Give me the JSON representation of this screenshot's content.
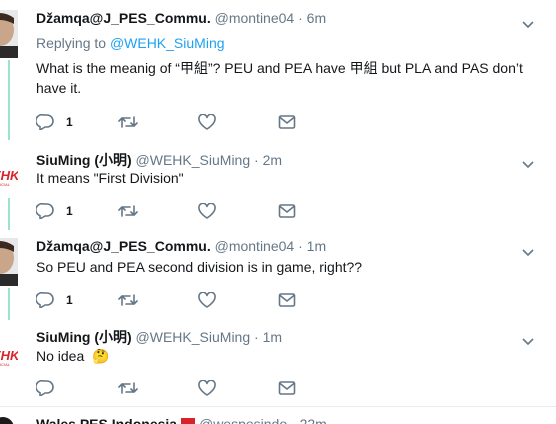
{
  "tweets": [
    {
      "name": "Džamqa@J_PES_Commu.",
      "handle": "@montine04",
      "sep": "·",
      "time": "6m",
      "replying_prefix": "Replying to ",
      "replying_to": "@WEHK_SiuMing",
      "text": "What is the meanig of “甲組”? PEU and PEA have 甲組 but PLA and PAS don’t have it.",
      "reply_count": "1"
    },
    {
      "name": "SiuMing (小明)",
      "handle": "@WEHK_SiuMing",
      "sep": "·",
      "time": "2m",
      "text": "It means \"First Division\"",
      "reply_count": "1"
    },
    {
      "name": "Džamqa@J_PES_Commu.",
      "handle": "@montine04",
      "sep": "·",
      "time": "1m",
      "text": "So PEU and PEA second division is in game, right??",
      "reply_count": "1"
    },
    {
      "name": "SiuMing (小明)",
      "handle": "@WEHK_SiuMing",
      "sep": "·",
      "time": "1m",
      "text": "No idea",
      "emoji": "🤔",
      "reply_count": ""
    }
  ],
  "partial_tweet": {
    "name": "Wales PES Indonesia",
    "handle": "@wespesindo · 22m"
  },
  "icons": [
    "reply-icon",
    "retweet-icon",
    "like-icon",
    "direct-message-icon",
    "chevron-down-icon"
  ],
  "colors": {
    "thread_line": "#9be4c9",
    "link": "#1da1f2",
    "muted": "#657786",
    "icon": "#657786",
    "wehk_red": "#d8232a"
  }
}
